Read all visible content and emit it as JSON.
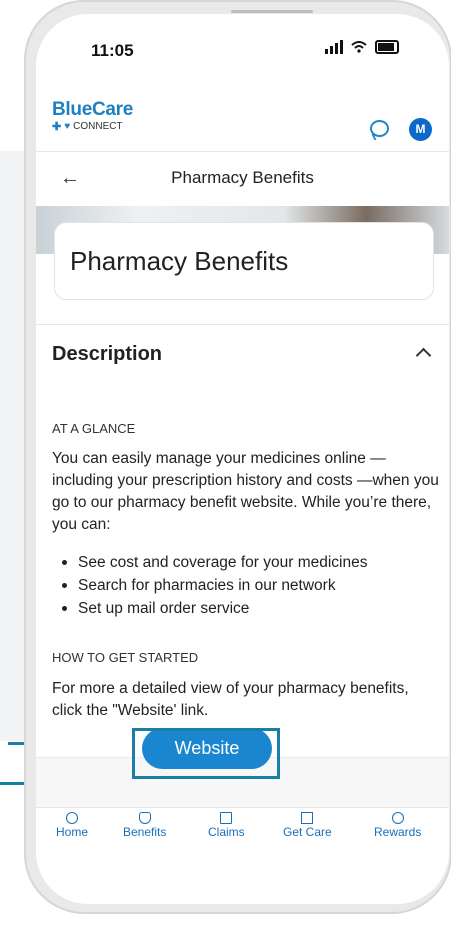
{
  "status": {
    "time": "11:05"
  },
  "app": {
    "logo_title": "BlueCare",
    "logo_sub": "CONNECT",
    "avatar_initial": "M"
  },
  "nav": {
    "title": "Pharmacy Benefits"
  },
  "card": {
    "title": "Pharmacy Benefits"
  },
  "description": {
    "heading": "Description",
    "glance_label": "AT A GLANCE",
    "glance_text": "You can easily manage your medicines online —including your prescription history and costs —when you go to our pharmacy benefit website. While you’re there, you can:",
    "bullets": [
      "See cost and coverage for your medicines",
      "Search for pharmacies in our network",
      "Set up mail order service"
    ],
    "start_label": "HOW TO GET STARTED",
    "start_text": "For more a detailed view of your pharmacy benefits, click the \"Website' link."
  },
  "website_button": "Website",
  "tabs": [
    {
      "label": "Home",
      "icon": "home-icon"
    },
    {
      "label": "Benefits",
      "icon": "benefits-icon"
    },
    {
      "label": "Claims",
      "icon": "claims-icon"
    },
    {
      "label": "Get Care",
      "icon": "get-care-icon"
    },
    {
      "label": "Rewards",
      "icon": "rewards-icon"
    }
  ],
  "colors": {
    "brand": "#1f7fc1",
    "button": "#1b86d0",
    "callout": "#1a7fa6"
  }
}
